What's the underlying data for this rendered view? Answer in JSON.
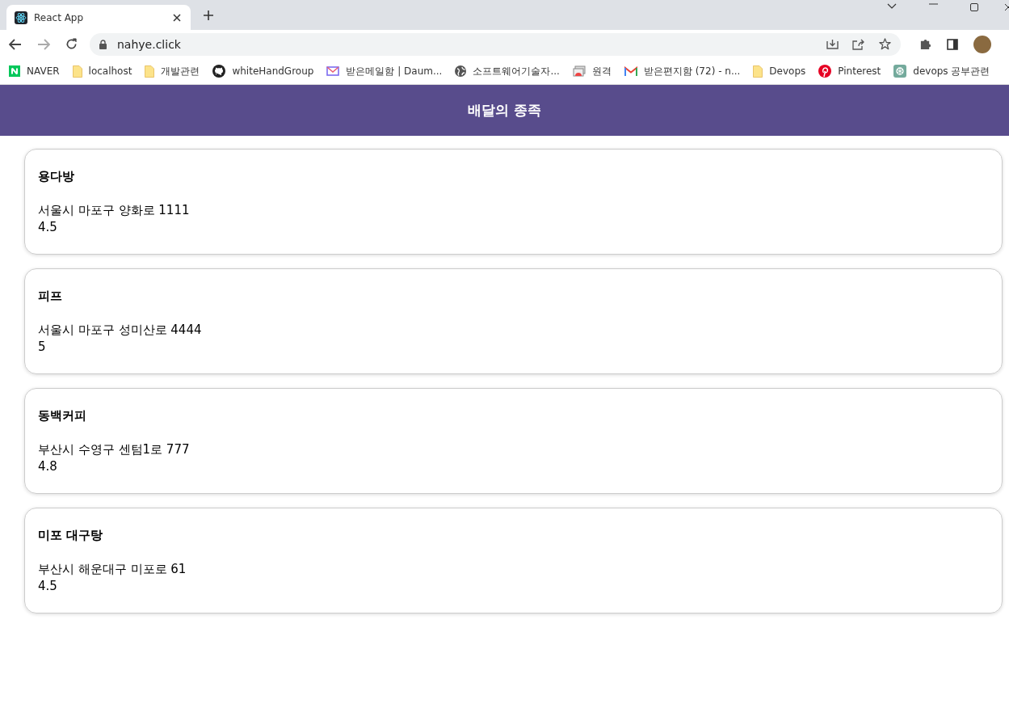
{
  "browser": {
    "tab": {
      "title": "React App",
      "selected": true
    },
    "address": "nahye.click",
    "bookmarks": [
      {
        "label": "NAVER",
        "kind": "naver"
      },
      {
        "label": "localhost",
        "kind": "folder"
      },
      {
        "label": "개발관련",
        "kind": "folder"
      },
      {
        "label": "whiteHandGroup",
        "kind": "github"
      },
      {
        "label": "받은메일함 | Daum...",
        "kind": "mail"
      },
      {
        "label": "소프트웨어기술자...",
        "kind": "globe"
      },
      {
        "label": "원격",
        "kind": "remote"
      },
      {
        "label": "받은편지함 (72) - n...",
        "kind": "gmail"
      },
      {
        "label": "Devops",
        "kind": "folder"
      },
      {
        "label": "Pinterest",
        "kind": "pinterest"
      },
      {
        "label": "devops 공부관련",
        "kind": "openai"
      }
    ]
  },
  "header": {
    "title": "배달의 종족"
  },
  "stores": [
    {
      "name": "용다방",
      "address": "서울시 마포구 양화로 1111",
      "rating": "4.5"
    },
    {
      "name": "피프",
      "address": "서울시 마포구 성미산로 4444",
      "rating": "5"
    },
    {
      "name": "동백커피",
      "address": "부산시 수영구 센텀1로 777",
      "rating": "4.8"
    },
    {
      "name": "미포 대구탕",
      "address": "부산시 해운대구 미포로 61",
      "rating": "4.5"
    }
  ]
}
